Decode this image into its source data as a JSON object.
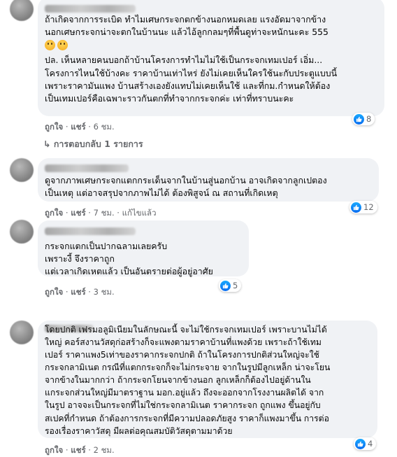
{
  "comments": [
    {
      "lines": [
        "ถ้าเกิดจากการระเบิด ทำไมเศษกระจกตกข้างนอกหมดเลย แรงอัดมาจากข้าง",
        "นอกเศษกระจกน่าจะตกในบ้านนะ แล้วไอ้ลูกกลมๆที่พื้นดูท่าจะหนักนะคะ 555",
        "",
        "",
        "ปล. เห็นหลายคนบอกถ้าบ้านโครงการทำไมไม่ใช้เป็นกระจกเทมเปอร์ เอิ่ม...",
        "โครงการไหนใช้บ้างคะ ราคาบ้านเท่าไหร่ ยังไม่เคยเห็นใครใช้นะกับประตูแบบนี้",
        "เพราะราคามันแพง บ้านสร้างเองยังแทบไม่เคยเห็นใช้ และที่กม.กำหนดให้ต้อง",
        "เป็นเทมเปอร์คือเฉพาะราวกันตกที่ทำจากกระจกค่ะ เท่าที่ทราบนะคะ"
      ],
      "like": "ถูกใจ",
      "share": "แชร์",
      "time": "6 ชม.",
      "edited": "",
      "reaction_count": "8",
      "replies": "การตอบกลับ 1 รายการ"
    },
    {
      "lines": [
        "ดูจากภาพเศษกระจกแตกกระเด็นจากในบ้านสู่นอกบ้าน อาจเกิดจากลูกเปตอง",
        "เป็นเหตุ แต่อาจสรุปจากภาพไม่ได้ ต้องพิสูจน์ ณ สถานที่เกิดเหตุ"
      ],
      "like": "ถูกใจ",
      "share": "แชร์",
      "time": "7 ชม.",
      "edited": "แก้ไขแล้ว",
      "reaction_count": "12"
    },
    {
      "lines": [
        "กระจกแตกเป็นปากฉลามเลยครับ",
        "เพราะงี้ จึงราคาถูก",
        "แต่เวลาเกิดเหตแล้ว เป็นอันตรายต่อผู้อยู่อาศัย"
      ],
      "like": "ถูกใจ",
      "share": "แชร์",
      "time": "3 ชม.",
      "edited": "",
      "reaction_count": "5"
    },
    {
      "lines": [
        "โดยปกติ เฟรมอลูมิเนียมในลักษณะนี้ จะไม่ใช้กระจกเทมเปอร์ เพราะบานไม่ได้",
        "ใหญ่ คอร์สงานวัสดุก่อสร้างก็จะแพงตามราคาบ้านที่แพงด้วย เพราะถ้าใช้เทม",
        "เปอร์ ราคาแพง5เท่าของราคากระจกปกติ ถ้าในโครงการปกติส่วนใหญ่จะใช้",
        "กระจกลามิเนต กรณีที่แตกกระจกก็จะไม่กระจาย จากในรูปมีลูกเหล็ก น่าจะโยน",
        "จากข้างในมากกว่า ถ้ากระจกโยนจากข้างนอก ลูกเหล็กก็ต้องไปอยู่ด้านใน",
        "แกระจกส่วนใหญ่มีมาตราฐาน มอก.อยู่แล้ว ถึงจะออกจากโรงงานผลิตได้ จาก",
        "ในรูป อาจจะเป็นกระจกที่ไม่ใช่กระจกลามิเนต ราคากระจก ถูกแพง ขึ้นอยู่กับ",
        "สเปคที่กำหนด ถ้าต้องการกระจกที่มีความปลอดภัยสูง ราคาก็แพงมาขึ้น การต่อ",
        "รองเรื่องราคาวัสดุ มีผลต่อคุณสมบัติวัสดุตามมาด้วย"
      ],
      "like": "ถูกใจ",
      "share": "แชร์",
      "time": "2 ชม.",
      "edited": "",
      "reaction_count": "4"
    }
  ],
  "emoji_icon": "grinning-face-icon",
  "like_icon": "thumbs-up-icon",
  "reply_arrow_icon": "reply-arrow-icon",
  "colors": {
    "bubble": "#f0f2f5",
    "meta": "#65676b",
    "like_blue": "#1877f2"
  }
}
